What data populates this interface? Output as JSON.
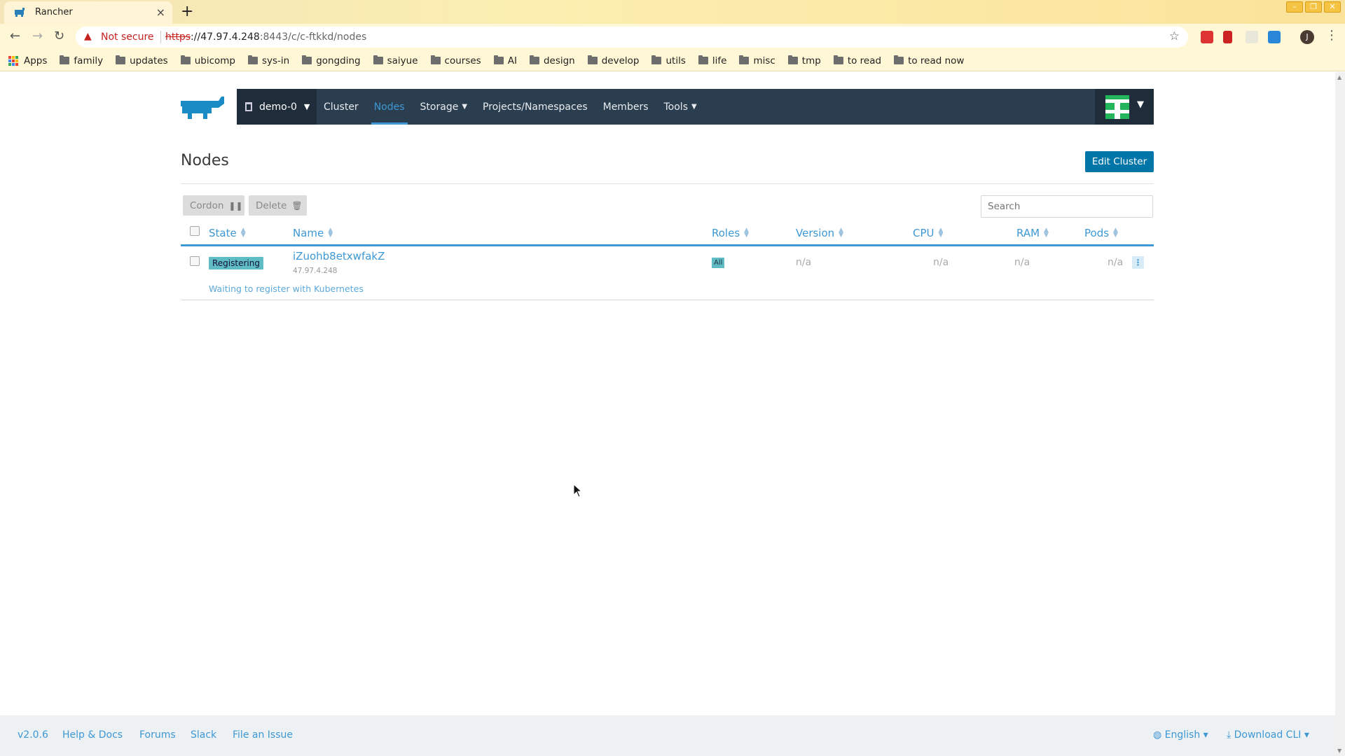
{
  "browser": {
    "tab_title": "Rancher",
    "tab_close": "×",
    "new_tab": "+",
    "security_label": "Not secure",
    "url_scheme": "https",
    "url_sep": "://",
    "url_host": "47.97.4.248",
    "url_path": ":8443/c/c-ftkkd/nodes",
    "profile_initial": "J",
    "bookmarks": [
      "Apps",
      "family",
      "updates",
      "ubicomp",
      "sys-in",
      "gongding",
      "saiyue",
      "courses",
      "AI",
      "design",
      "develop",
      "utils",
      "life",
      "misc",
      "tmp",
      "to read",
      "to read now"
    ]
  },
  "nav": {
    "cluster": "demo-0",
    "links": [
      {
        "label": "Cluster"
      },
      {
        "label": "Nodes"
      },
      {
        "label": "Storage"
      },
      {
        "label": "Projects/Namespaces"
      },
      {
        "label": "Members"
      },
      {
        "label": "Tools"
      }
    ]
  },
  "page": {
    "title": "Nodes",
    "edit_button": "Edit Cluster",
    "cordon": "Cordon",
    "delete": "Delete",
    "search_placeholder": "Search"
  },
  "table": {
    "columns": [
      "State",
      "Name",
      "Roles",
      "Version",
      "CPU",
      "RAM",
      "Pods"
    ],
    "rows": [
      {
        "state": "Registering",
        "name": "iZuohb8etxwfakZ",
        "ip": "47.97.4.248",
        "roles": "All",
        "version": "n/a",
        "cpu": "n/a",
        "ram": "n/a",
        "pods": "n/a",
        "message": "Waiting to register with Kubernetes"
      }
    ]
  },
  "footer": {
    "version": "v2.0.6",
    "help": "Help & Docs",
    "forums": "Forums",
    "slack": "Slack",
    "issue": "File an Issue",
    "language": "English",
    "download": "Download CLI"
  },
  "colors": {
    "nav_bg": "#2b3e50",
    "accent": "#3d98d3",
    "primary_button": "#0075a8",
    "badge": "#5fbbc4"
  }
}
